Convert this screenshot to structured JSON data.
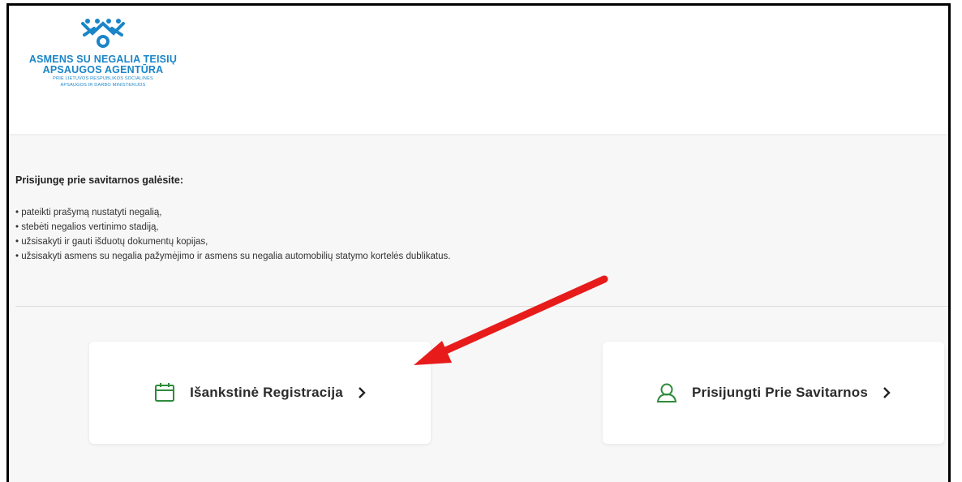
{
  "header": {
    "logo": {
      "name_line1": "ASMENS SU NEGALIA TEISIŲ",
      "name_line2": "APSAUGOS AGENTŪRA",
      "sub_line1": "PRIE LIETUVOS RESPUBLIKOS SOCIALINĖS",
      "sub_line2": "APSAUGOS IR DARBO MINISTERIJOS",
      "icon": "people-circle-logo-icon",
      "color": "#1a85c8"
    }
  },
  "intro": {
    "title": "Prisijungę prie savitarnos galėsite:",
    "items": [
      "• pateikti prašymą nustatyti negalią,",
      "• stebėti negalios vertinimo stadiją,",
      "• užsisakyti ir gauti išduotų dokumentų kopijas,",
      "• užsisakyti asmens su negalia pažymėjimo ir asmens su negalia automobilių statymo kortelės dublikatus."
    ]
  },
  "actions": {
    "preregistration": {
      "label": "Išankstinė Registracija",
      "icon": "calendar-icon",
      "chevron": "chevron-right-icon"
    },
    "self_service": {
      "label": "Prisijungti Prie Savitarnos",
      "icon": "user-icon",
      "chevron": "chevron-right-icon"
    },
    "icon_color": "#2e8b3a"
  },
  "annotation": {
    "arrow_color": "#e81b1b"
  }
}
